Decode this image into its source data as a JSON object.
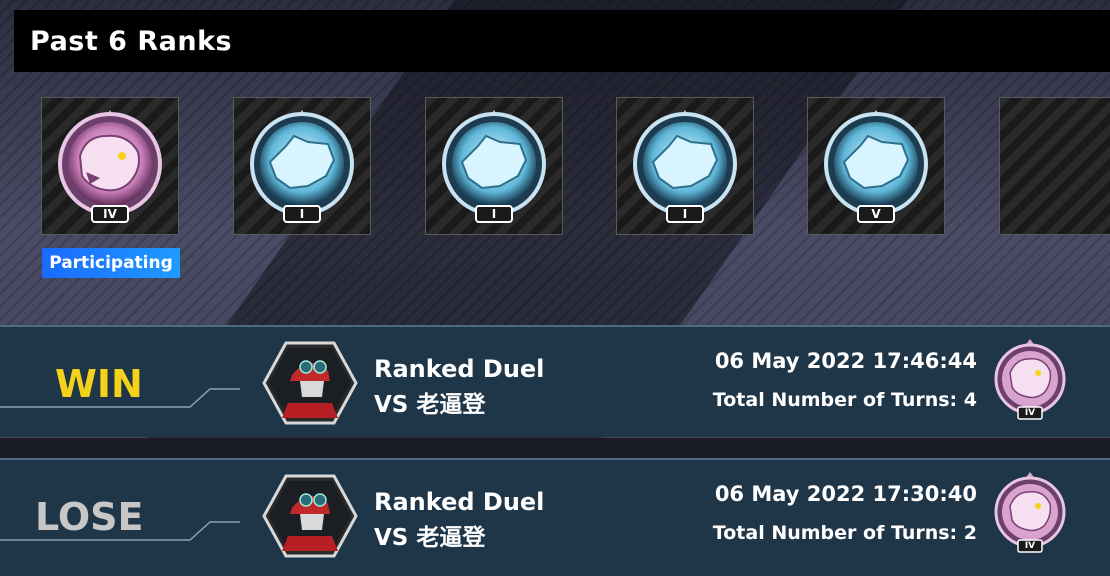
{
  "header": {
    "title": "Past 6 Ranks"
  },
  "ranks": [
    {
      "tier": "IV",
      "type": "bear-pink"
    },
    {
      "tier": "I",
      "type": "wolf-cyan"
    },
    {
      "tier": "I",
      "type": "wolf-cyan"
    },
    {
      "tier": "I",
      "type": "wolf-cyan"
    },
    {
      "tier": "V",
      "type": "wolf-cyan"
    },
    {
      "tier": "",
      "type": "empty"
    }
  ],
  "participating_label": "Participating",
  "duels": [
    {
      "result": "WIN",
      "mode": "Ranked Duel",
      "opponent": "VS 老逼登",
      "datetime": "06 May 2022 17:46:44",
      "turns": "Total Number of Turns: 4",
      "rank_tier": "IV"
    },
    {
      "result": "LOSE",
      "mode": "Ranked Duel",
      "opponent": "VS 老逼登",
      "datetime": "06 May 2022 17:30:40",
      "turns": "Total Number of Turns: 2",
      "rank_tier": "IV"
    }
  ],
  "colors": {
    "win": "#f5d21a",
    "lose": "#c7c7c7",
    "participating": "#1a6aff",
    "row_bg": "#1f3548"
  }
}
